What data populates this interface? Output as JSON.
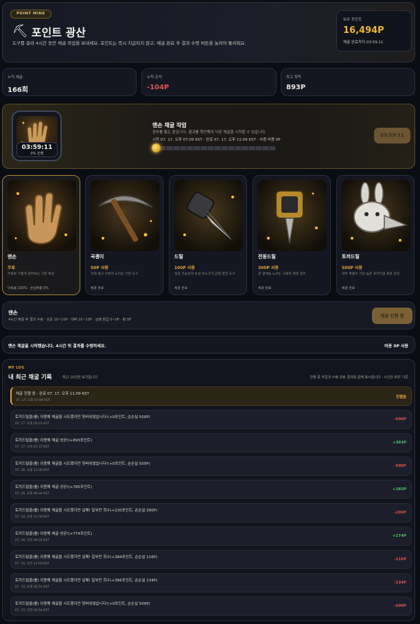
{
  "header": {
    "badge": "POINT MINE",
    "title": "포인트 광산",
    "description": "도구를 골라 4시간 동안 채굴 작업을 보내세요. 포인트는 즉시 지급되지 않고, 채굴 완료 후 결과 수령 버튼을 눌러야 돌려줘요.",
    "balance_label": "보유 포인트",
    "balance_value": "16,494P",
    "balance_sub": "채굴 완료까지 03:59:11"
  },
  "stats": [
    {
      "label": "누적 채굴",
      "value": "166회"
    },
    {
      "label": "누적 손익",
      "value": "-104P"
    },
    {
      "label": "최고 획득",
      "value": "893P"
    }
  ],
  "active": {
    "timer": "03:59:11",
    "progress_label": "0% 진행",
    "title": "맨손 채굴 작업",
    "subtitle": "광부를 통는 중입니다. 결과를 확인해야 다른 채굴을 시작할 수 있습니다.",
    "time_range": "시작 07. 17. 오후 07:09 KST · 완료 07. 17. 오후 11:09 KST · 사용 비용 0P",
    "progress": 0.02,
    "button": "03:59:11"
  },
  "tools": [
    {
      "name": "맨손",
      "price": "무료",
      "desc": "무료로 가볍게 굴러보는 기본 채굴",
      "foot": "아득율 100% · 손실확률 0%"
    },
    {
      "name": "곡괭이",
      "price": "50P 사용",
      "desc": "작게 들고 꾸준히 노리는 기본 도구",
      "foot": "채굴 완료"
    },
    {
      "name": "드릴",
      "price": "100P 사용",
      "desc": "성공 가능성과 손실 리스크가 균형 잡힌 도구",
      "foot": "채굴 완료"
    },
    {
      "name": "전동드릴",
      "price": "300P 사용",
      "desc": "큰 광맥을 노리는 고출력 채굴 장비",
      "foot": "채굴 완료"
    },
    {
      "name": "토끼드릴",
      "price": "500P 사용",
      "desc": "대박 확률이 가장 높은 프리미엄 채굴 장비",
      "foot": "채굴 완료"
    }
  ],
  "selection": {
    "name": "맨손",
    "detail": "4시간 채굴 후 결과 수령 · 성공 10~10P · 대박 10~10P · 실패 환급 0~0P · 평 0P",
    "button": "채굴 진행 중"
  },
  "notice": {
    "message": "맨손 채굴을 시작했습니다. 4시간 뒤 결과를 수령하세요.",
    "right": "비용 0P 사용"
  },
  "log": {
    "badge": "MY LOG",
    "title": "내 최근 채굴 기록",
    "subtitle": "· 최근 10건만 표기합니다",
    "note": "진행 중 작업과 수령 완료 결과를 함께 표시합니다 · 시간은 KST 기준",
    "rows": [
      {
        "text": "채굴 진행 중 · 완료 07. 17. 오후 11:09 KST",
        "time": "07. 17. 오후 07:09 KST",
        "amount": "진행중",
        "type": "active"
      },
      {
        "text": "토끼드릴을(를) 이용해 채굴을 시도했지만 헛바위였습니다!(+0포인트, 순손실 500P)",
        "time": "07. 17. 오후 02:03 KST",
        "amount": "-500P",
        "type": "neg"
      },
      {
        "text": "토끼드릴을(를) 이용해 채굴 성공!(+893포인트)",
        "time": "07. 17. 오전 07:37 KST",
        "amount": "+393P",
        "type": "pos"
      },
      {
        "text": "토끼드릴을(를) 이용해 채굴을 시도했지만 헛바위였습니다!(+0포인트, 순손실 500P)",
        "time": "07. 16. 오후 11:30 KST",
        "amount": "-500P",
        "type": "neg"
      },
      {
        "text": "토끼드릴을(를) 이용해 채굴 성공!(+785포인트)",
        "time": "07. 16. 오후 06:44 KST",
        "amount": "+285P",
        "type": "pos"
      },
      {
        "text": "토끼드릴을(를) 이용해 채굴을 시도했지만 실패! 일부만 회수(+220포인트, 순손실 280P)",
        "time": "07. 16. 오후 01:58 KST",
        "amount": "-280P",
        "type": "neg"
      },
      {
        "text": "토끼드릴을(를) 이용해 채굴 성공!(+774포인트)",
        "time": "07. 16. 오전 09:31 KST",
        "amount": "+274P",
        "type": "pos"
      },
      {
        "text": "토끼드릴을(를) 이용해 채굴을 시도했지만 실패! 일부만 회수(+384포인트, 순손실 116P)",
        "time": "07. 16. 오전 12:03 KST",
        "amount": "-116P",
        "type": "neg"
      },
      {
        "text": "토끼드릴을(를) 이용해 채굴을 시도했지만 실패! 일부만 회수(+366포인트, 순손실 134P)",
        "time": "07. 15. 오후 06:31 KST",
        "amount": "-134P",
        "type": "neg"
      },
      {
        "text": "토끼드릴을(를) 이용해 채굴을 시도했지만 헛바위였습니다!(+0포인트, 순손실 500P)",
        "time": "07. 15. 오전 02:54 KST",
        "amount": "-500P",
        "type": "neg"
      }
    ]
  },
  "colors": {
    "accent": "#e0a13b",
    "positive": "#4fc267",
    "negative": "#e25252",
    "background": "#0b0d14"
  }
}
